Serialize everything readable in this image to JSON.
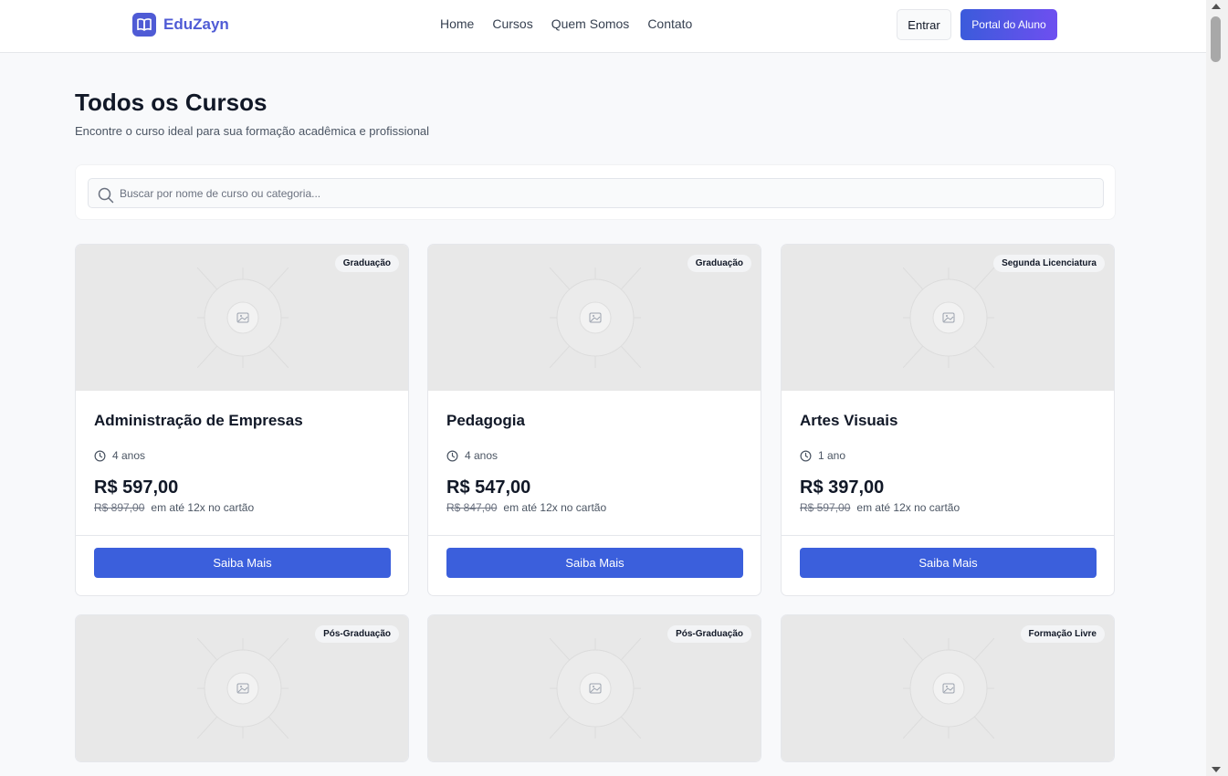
{
  "header": {
    "logo_text": "EduZayn",
    "nav": [
      "Home",
      "Cursos",
      "Quem Somos",
      "Contato"
    ],
    "login_label": "Entrar",
    "portal_label": "Portal do Aluno"
  },
  "page": {
    "title": "Todos os Cursos",
    "subtitle": "Encontre o curso ideal para sua formação acadêmica e profissional"
  },
  "search": {
    "placeholder": "Buscar por nome de curso ou categoria..."
  },
  "courses": [
    {
      "category": "Graduação",
      "name": "Administração de Empresas",
      "duration": "4 anos",
      "price": "R$ 597,00",
      "old_price": "R$ 897,00",
      "installments": "em até 12x no cartão",
      "cta": "Saiba Mais"
    },
    {
      "category": "Graduação",
      "name": "Pedagogia",
      "duration": "4 anos",
      "price": "R$ 547,00",
      "old_price": "R$ 847,00",
      "installments": "em até 12x no cartão",
      "cta": "Saiba Mais"
    },
    {
      "category": "Segunda Licenciatura",
      "name": "Artes Visuais",
      "duration": "1 ano",
      "price": "R$ 397,00",
      "old_price": "R$ 597,00",
      "installments": "em até 12x no cartão",
      "cta": "Saiba Mais"
    },
    {
      "category": "Pós-Graduação"
    },
    {
      "category": "Pós-Graduação"
    },
    {
      "category": "Formação Livre"
    }
  ],
  "colors": {
    "brand": "#4f5bd5",
    "primary_button": "#3b5fdc",
    "portal_gradient_start": "#3b5bdb",
    "portal_gradient_end": "#6e4ff0"
  },
  "icons": {
    "logo": "open-book-icon",
    "search": "search-icon",
    "duration": "clock-icon",
    "image_placeholder": "image-placeholder-icon"
  }
}
